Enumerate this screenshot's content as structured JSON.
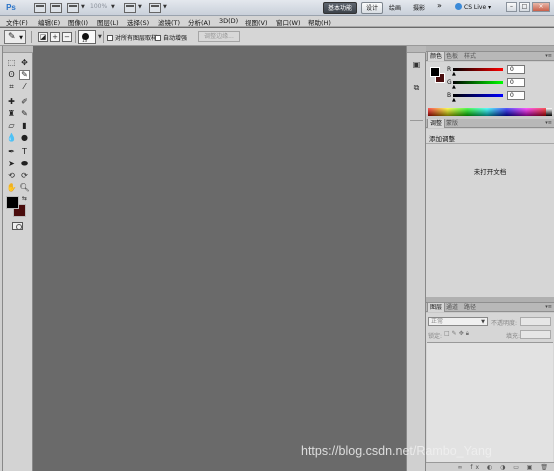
{
  "titlebar": {
    "app_logo": "Ps",
    "zoom": "100%",
    "workspaces": {
      "essentials": "基本功能",
      "design": "设计",
      "painting": "绘画",
      "photography": "摄影",
      "more": "»"
    },
    "cs_live": "CS Live",
    "window_controls": {
      "minimize": "–",
      "restore": "□",
      "close": "×"
    }
  },
  "menu": [
    "文件(F)",
    "编辑(E)",
    "图像(I)",
    "图层(L)",
    "选择(S)",
    "滤镜(T)",
    "分析(A)",
    "3D(D)",
    "视图(V)",
    "窗口(W)",
    "帮助(H)"
  ],
  "options": {
    "brush_size": "13",
    "sample_all_layers": "对所有图层取样",
    "auto_enhance": "自动增强",
    "refine_edge": "调整边缘..."
  },
  "tools": {
    "foreground_color": "#000000",
    "background_color": "#4a0d0d"
  },
  "color_panel": {
    "tabs": [
      "颜色",
      "色板",
      "样式"
    ],
    "channels": [
      {
        "label": "R",
        "value": "0"
      },
      {
        "label": "G",
        "value": "0"
      },
      {
        "label": "B",
        "value": "0"
      }
    ]
  },
  "adjustments_panel": {
    "tabs": [
      "调整",
      "蒙版"
    ],
    "title": "添加调整",
    "message": "未打开文档"
  },
  "layers_panel": {
    "tabs": [
      "图层",
      "通道",
      "路径"
    ],
    "blend_mode": "正常",
    "opacity_label": "不透明度:",
    "lock_label": "锁定:",
    "fill_label": "填充:"
  },
  "watermark": "https://blog.csdn.net/Rambo_Yang"
}
